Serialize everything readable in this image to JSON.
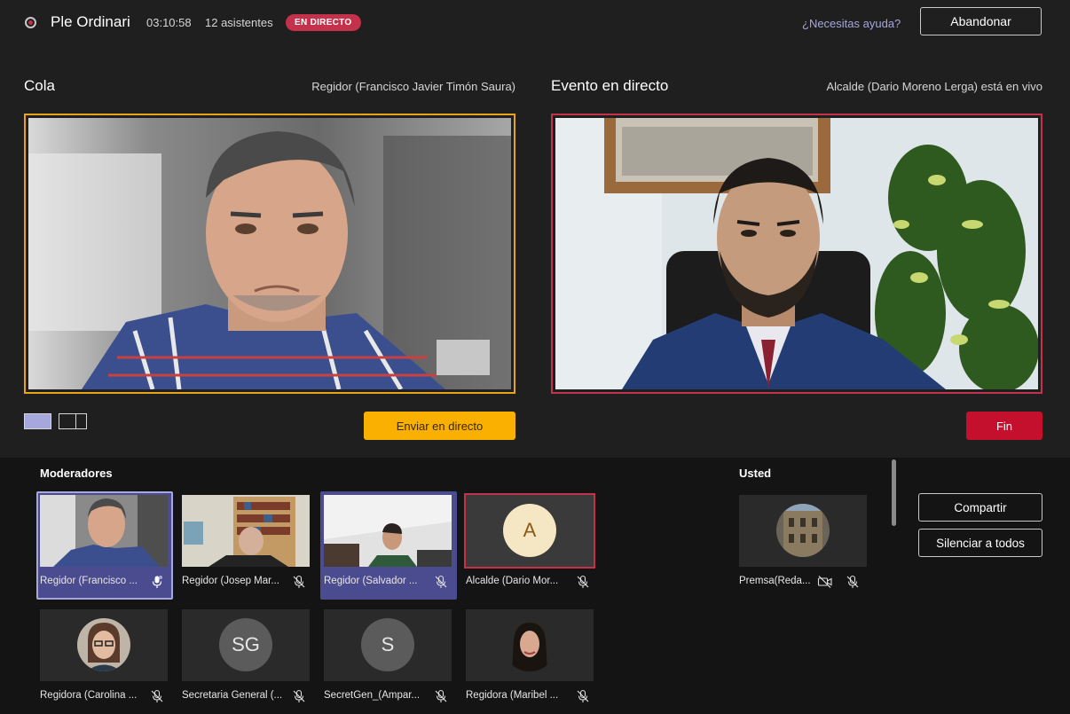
{
  "header": {
    "title": "Ple Ordinari",
    "timer": "03:10:58",
    "attendees": "12 asistentes",
    "live_badge": "EN DIRECTO",
    "help_link": "¿Necesitas ayuda?",
    "leave_button": "Abandonar"
  },
  "queue": {
    "title": "Cola",
    "presenter": "Regidor (Francisco Javier Timón Saura)",
    "send_button": "Enviar en directo"
  },
  "live_event": {
    "title": "Evento en directo",
    "presenter": "Alcalde (Dario Moreno Lerga) está en vivo",
    "end_button": "Fin"
  },
  "moderators": {
    "heading": "Moderadores",
    "tiles": [
      {
        "label": "Regidor (Francisco ...",
        "mic": "mic-on"
      },
      {
        "label": "Regidor (Josep Mar...",
        "mic": "mic-off"
      },
      {
        "label": "Regidor (Salvador ...",
        "mic": "mic-off"
      },
      {
        "label": "Alcalde (Dario Mor...",
        "mic": "mic-off",
        "initial": "A"
      },
      {
        "label": "Regidora (Carolina ...",
        "mic": "mic-off"
      },
      {
        "label": "Secretaria General (...",
        "mic": "mic-off",
        "initial": "SG"
      },
      {
        "label": "SecretGen_(Ampar...",
        "mic": "mic-off",
        "initial": "S"
      },
      {
        "label": "Regidora (Maribel ...",
        "mic": "mic-off"
      }
    ]
  },
  "you": {
    "heading": "Usted",
    "label": "Premsa(Reda..."
  },
  "actions": {
    "share": "Compartir",
    "mute_all": "Silenciar a todos"
  },
  "colors": {
    "live": "#c4314b",
    "queue_border": "#e8a417",
    "send_button": "#f9b000",
    "accent": "#a6a7dc",
    "tile_selected": "#4b4c8f"
  }
}
